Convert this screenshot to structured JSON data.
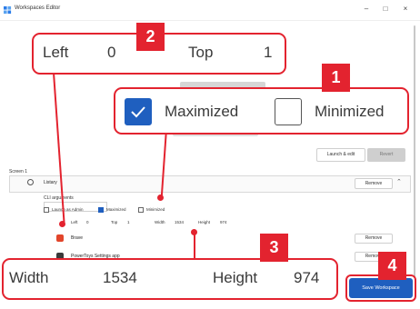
{
  "window": {
    "title": "Workspaces Editor",
    "minimize_glyph": "–",
    "maximize_glyph": "□",
    "close_glyph": "×"
  },
  "toolbar": {
    "launch_edit": "Launch & edit",
    "reset": "Revert"
  },
  "section_label": "Screen 1",
  "app_card": {
    "name": "Listary",
    "remove": "Remove",
    "chevron": "⌃"
  },
  "cli_label": "CLI arguments",
  "mini_options": {
    "launch_admin": "Launch as Admin",
    "maximized": "Maximized",
    "minimized": "Minimized"
  },
  "mini_position": {
    "left_label": "Left",
    "left_value": "0",
    "top_label": "Top",
    "top_value": "1",
    "width_label": "Width",
    "width_value": "1534",
    "height_label": "Height",
    "height_value": "974"
  },
  "app_rows": [
    {
      "name": "Brave",
      "remove": "Remove",
      "icon_color": "#e2452b"
    },
    {
      "name": "PowerToys Settings app",
      "remove": "Remove",
      "icon_color": "#3a3a3a"
    }
  ],
  "callouts": {
    "c1": {
      "badge": "1",
      "maximized_label": "Maximized",
      "minimized_label": "Minimized",
      "maximized_checked": true,
      "minimized_checked": false
    },
    "c2": {
      "badge": "2",
      "left_label": "Left",
      "left_value": "0",
      "top_label": "Top",
      "top_value": "1"
    },
    "c3": {
      "badge": "3",
      "width_label": "Width",
      "width_value": "1534",
      "height_label": "Height",
      "height_value": "974"
    },
    "c4": {
      "badge": "4"
    }
  },
  "save_button": "Save Workspace",
  "colors": {
    "accent": "#e3232f",
    "primary": "#1f5fbf"
  }
}
